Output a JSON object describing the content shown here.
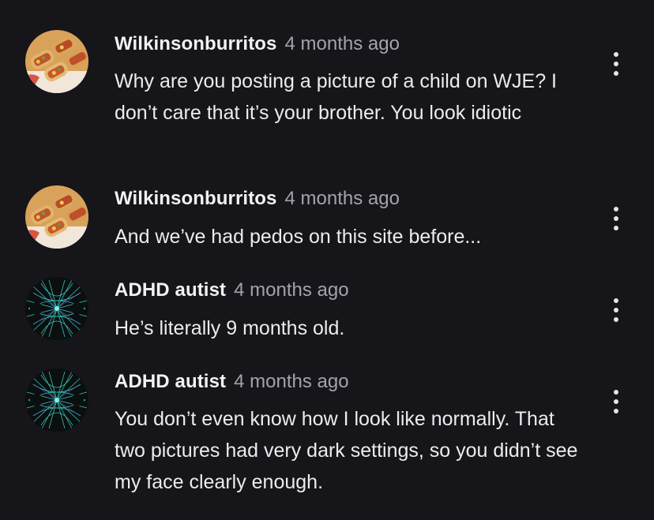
{
  "comments": [
    {
      "username": "Wilkinsonburritos",
      "time": "4 months ago",
      "text": "Why are you posting a picture of a child on WJE? I don’t care that it’s your brother. You look idiotic",
      "avatar": "burrito-food-avatar",
      "menu_icon": "more-vertical-icon"
    },
    {
      "username": "Wilkinsonburritos",
      "time": "4 months ago",
      "text": "And we’ve had pedos on this site before...",
      "avatar": "burrito-food-avatar",
      "menu_icon": "more-vertical-icon"
    },
    {
      "username": "ADHD autist",
      "time": "4 months ago",
      "text": "He’s literally 9 months old.",
      "avatar": "cyan-fractal-avatar",
      "menu_icon": "more-vertical-icon"
    },
    {
      "username": "ADHD autist",
      "time": "4 months ago",
      "text": "You don’t even know how I look like normally. That two pictures had very dark settings, so you didn’t see my face clearly enough.",
      "avatar": "cyan-fractal-avatar",
      "menu_icon": "more-vertical-icon"
    }
  ],
  "colors": {
    "background": "#15151a",
    "text": "#ececf0",
    "timestamp": "#a3a3aa",
    "fractal": "#3fd6c8"
  }
}
